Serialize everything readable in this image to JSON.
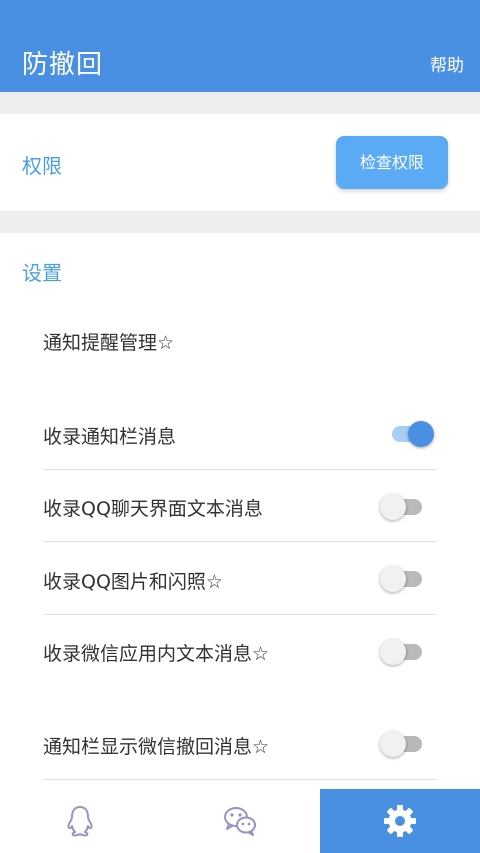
{
  "appbar": {
    "title": "防撤回",
    "help_label": "帮助"
  },
  "permissions": {
    "label": "权限",
    "button_label": "检查权限"
  },
  "settings": {
    "title": "设置",
    "items": [
      {
        "label": "通知提醒管理☆",
        "type": "link"
      },
      {
        "label": "收录通知栏消息",
        "type": "toggle",
        "enabled": true
      },
      {
        "label": "收录QQ聊天界面文本消息",
        "type": "toggle",
        "enabled": false
      },
      {
        "label": "收录QQ图片和闪照☆",
        "type": "toggle",
        "enabled": false
      },
      {
        "label": "收录微信应用内文本消息☆",
        "type": "toggle",
        "enabled": false
      },
      {
        "label": "通知栏显示微信撤回消息☆",
        "type": "toggle",
        "enabled": false
      }
    ]
  },
  "bottom_nav": {
    "items": [
      {
        "icon": "qq-penguin-icon",
        "active": false
      },
      {
        "icon": "wechat-icon",
        "active": false
      },
      {
        "icon": "gear-icon",
        "active": true
      }
    ]
  },
  "colors": {
    "primary": "#4a90e2",
    "accent_text": "#4a9fe8",
    "button": "#5aaaf5",
    "nav_icon": "#9b8fc4",
    "background_gap": "#eeeeee"
  }
}
